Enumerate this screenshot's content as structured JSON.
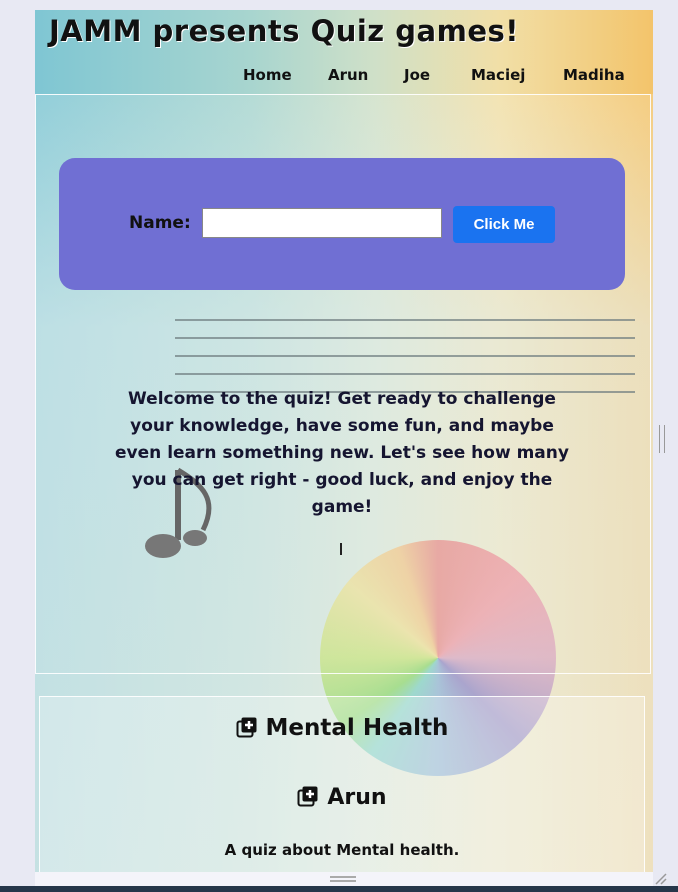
{
  "header": {
    "title": "JAMM presents Quiz games!"
  },
  "nav": {
    "items": [
      "Home",
      "Arun",
      "Joe",
      "Maciej",
      "Madiha"
    ]
  },
  "form": {
    "name_label": "Name:",
    "name_value": "",
    "button_label": "Click Me"
  },
  "intro": {
    "text": "Welcome to the quiz! Get ready to challenge your knowledge, have some fun, and maybe even learn something new. Let's see how many you can get right - good luck, and enjoy the game!"
  },
  "quiz": {
    "category": "Mental Health",
    "author": "Arun",
    "description": "A quiz about Mental health."
  },
  "colors": {
    "card": "#706fd3",
    "button": "#1a73f0"
  },
  "icons": {
    "section_icon": "plus-square-icon"
  }
}
